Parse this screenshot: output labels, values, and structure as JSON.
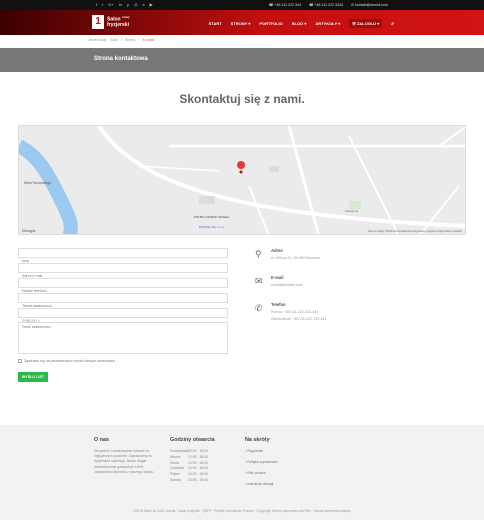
{
  "topbar": {
    "social_icons": [
      "facebook-icon",
      "twitter-icon",
      "google-plus-icon",
      "linkedin-icon",
      "pinterest-icon",
      "dribbble-icon",
      "skype-icon",
      "youtube-icon"
    ],
    "phone1": "+48 111 222 344",
    "phone2": "+48 111 222 3344",
    "email": "kontakt@strona.com"
  },
  "header": {
    "logo_mark": "1",
    "logo_line1": "Salon",
    "logo_sup": "nowy",
    "logo_line2": "fryzjerski",
    "nav": [
      "START",
      "STRONY ▾",
      "PORTFOLIO",
      "BLOG ▾",
      "ARTYKUŁY ▾"
    ],
    "login": "☰ ZALOGUJ ▾",
    "search_icon": "⌕"
  },
  "breadcrumb": [
    "Jesteś tutaj:",
    "Start",
    "/",
    "Strony",
    "/",
    "Kontakt"
  ],
  "page_title": "Strona kontaktowa",
  "heading": "Skontaktuj się z nami.",
  "map": {
    "google": "Google",
    "attribution": "Dane do Mapy ©2018 Google   Warunki korzystania z programu   Zgłoś błąd w mapach",
    "places": [
      "Most Toruńskiego",
      "PW BIG NIOROK MASELI",
      "MATPOL Sp. z o.o.",
      "Kawiarnia"
    ]
  },
  "form": {
    "name_placeholder": "Imię",
    "email_placeholder": "Adres e-mail",
    "phone_placeholder": "Numer telefonu",
    "subject_placeholder": "Temat wiadomości",
    "captcha_placeholder": "2+3(2+1) =",
    "message_placeholder": "Treść wiadomości",
    "consent": "Zgadzam się na przetwarzanie moich danych osobowych...",
    "send": "WYŚLIJ LIST"
  },
  "info": {
    "address_label": "Adres",
    "address_value": "ul. Wilcza 21, 35-089 Rzeszów",
    "email_label": "E-mail",
    "email_value": "email@domain.com",
    "phone_label": "Telefon",
    "phone_value1": "Pomoc: +48 111-222-333-444",
    "phone_value2": "Zamówienia: +48 111-222-333-444"
  },
  "footer": {
    "about_title": "O nas",
    "about_text": "Strzyżenie i modelowanie włosów na najwyższym poziomie. Zapraszamy do fryzjerskim stylizację. Nasze długie doświadczenie gwarantuje 100% zadowolenia klientów z naszego salonu.",
    "hours_title": "Godziny otwarcia",
    "hours": [
      [
        "Poniedziałek",
        "10:00 - 18:00"
      ],
      [
        "Wtorek",
        "10:00 - 18:00"
      ],
      [
        "Środa",
        "10:00 - 18:00"
      ],
      [
        "Czwartek",
        "10:00 - 18:00"
      ],
      [
        "Piątek",
        "10:00 - 18:00"
      ],
      [
        "Sobota",
        "10:00 - 15:00"
      ]
    ],
    "links_title": "Na skróty",
    "links": [
      "› Regulamin",
      "› Polityka prywatności",
      "› Pliki cookies",
      "› Instrukcje obsługi"
    ],
    "copyright": "©2018 Salon do CMS Joomla · Salon fryzjerski · QDPF · Projekt i wdrożenie: Poznań · Copyright: Strony internetowe dla Firm · Strona internetowa sklepu"
  }
}
